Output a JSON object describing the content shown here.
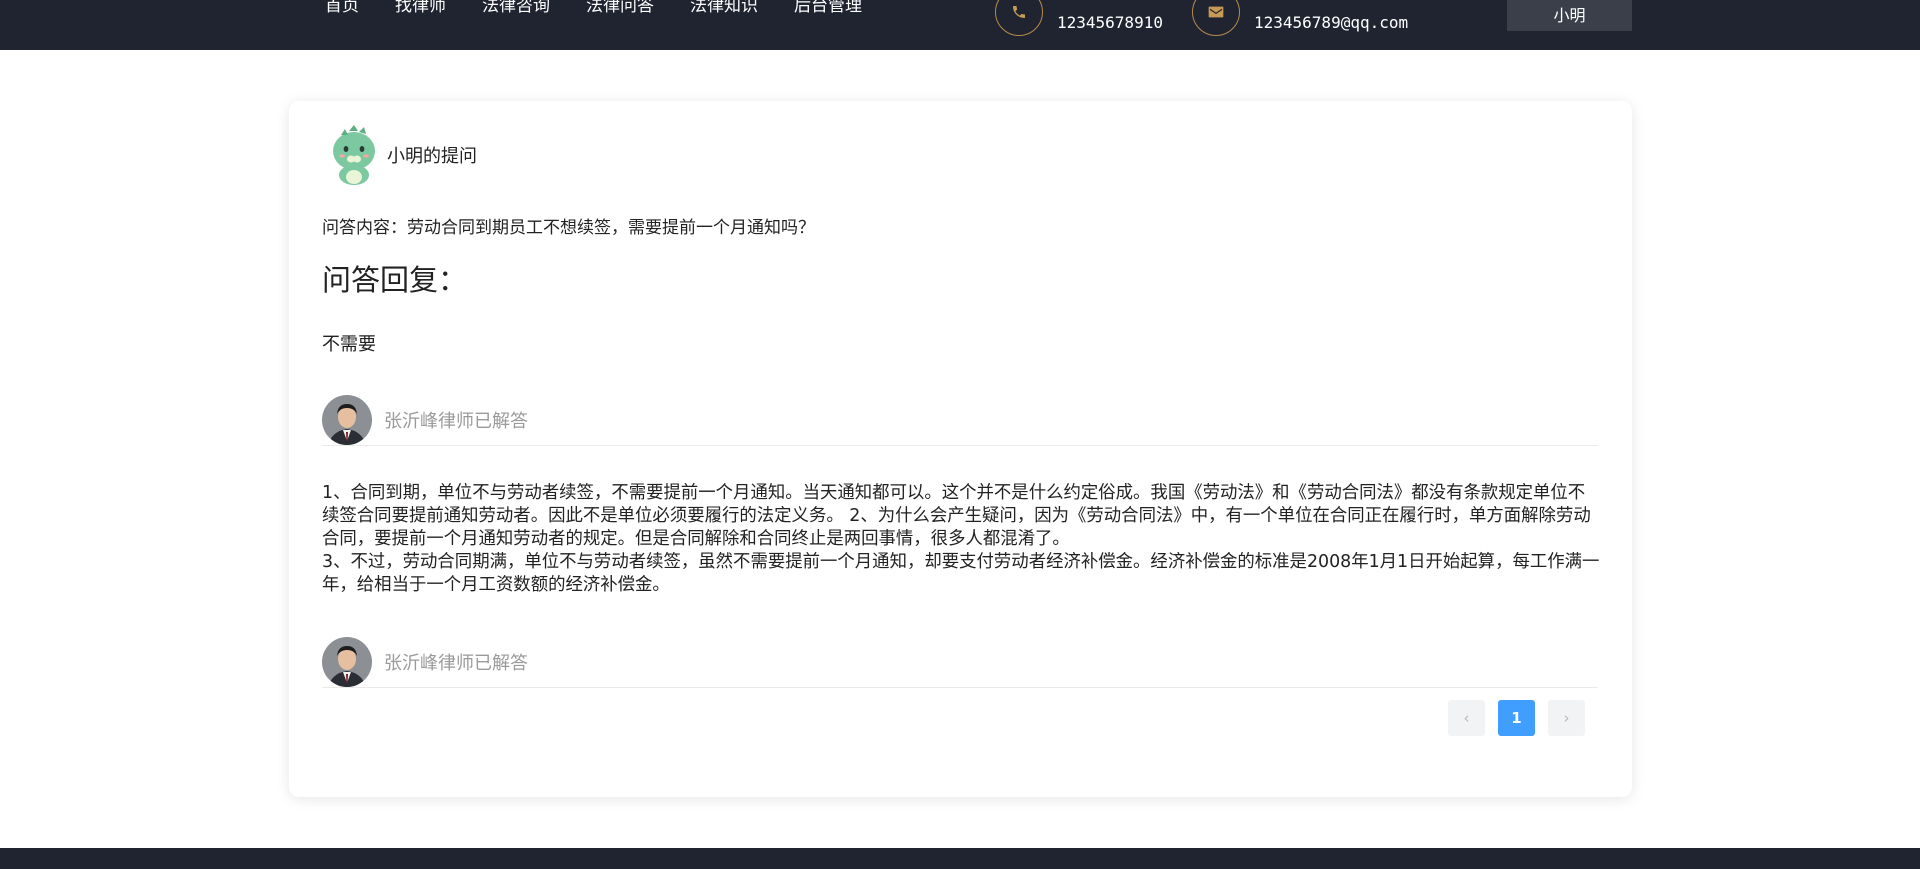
{
  "nav": {
    "items": [
      {
        "label": "首页"
      },
      {
        "label": "找律师"
      },
      {
        "label": "法律咨询"
      },
      {
        "label": "法律问答"
      },
      {
        "label": "法律知识"
      },
      {
        "label": "后台管理"
      }
    ]
  },
  "contact": {
    "phone": "12345678910",
    "email": "123456789@qq.com"
  },
  "user": {
    "name": "小明"
  },
  "question": {
    "asker_title": "小明的提问",
    "content": "问答内容：劳动合同到期员工不想续签，需要提前一个月通知吗？"
  },
  "reply": {
    "title": "问答回复：",
    "short_answer": "不需要"
  },
  "answers": [
    {
      "lawyer_label": "张沂峰律师已解答",
      "paragraphs": [
        "1、合同到期，单位不与劳动者续签，不需要提前一个月通知。当天通知都可以。这个并不是什么约定俗成。我国《劳动法》和《劳动合同法》都没有条款规定单位不续签合同要提前通知劳动者。因此不是单位必须要履行的法定义务。 2、为什么会产生疑问，因为《劳动合同法》中，有一个单位在合同正在履行时，单方面解除劳动合同，要提前一个月通知劳动者的规定。但是合同解除和合同终止是两回事情，很多人都混淆了。",
        "3、不过，劳动合同期满，单位不与劳动者续签，虽然不需要提前一个月通知，却要支付劳动者经济补偿金。经济补偿金的标准是2008年1月1日开始起算，每工作满一年，给相当于一个月工资数额的经济补偿金。"
      ]
    },
    {
      "lawyer_label": "张沂峰律师已解答"
    }
  ],
  "pagination": {
    "prev": "‹",
    "current": "1",
    "next": "›"
  },
  "colors": {
    "topbar": "#1f2430",
    "accent_gold": "#c79a55",
    "page_active": "#409eff"
  },
  "icons": {
    "phone": "phone-icon",
    "email": "mail-icon"
  }
}
